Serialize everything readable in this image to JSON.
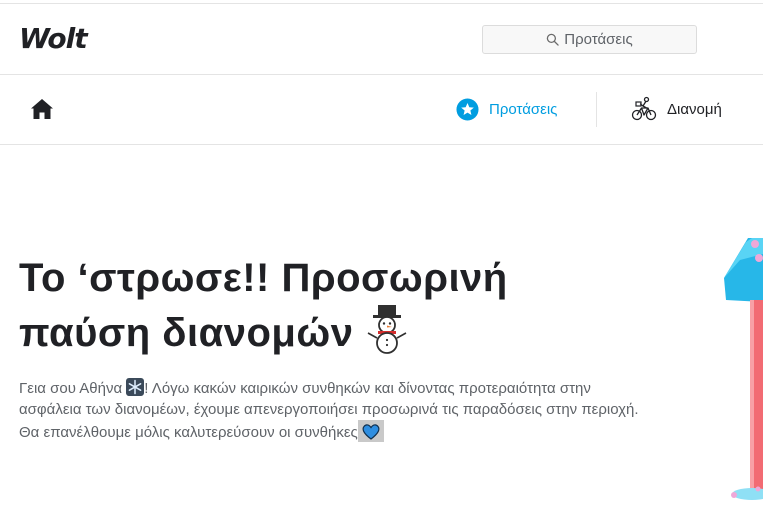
{
  "header": {
    "logo": "Wolt",
    "search": {
      "label": "Προτάσεις",
      "icon": "search-icon"
    }
  },
  "nav": {
    "home_icon": "home-icon",
    "recommendations": {
      "label": "Προτάσεις",
      "icon": "star-icon",
      "active": true
    },
    "delivery": {
      "label": "Διανομή",
      "icon": "bicycle-courier-icon"
    }
  },
  "hero": {
    "title_line1": "Το ‘στρωσε!! Προσωρινή",
    "title_line2": "παύση διανομών",
    "title_emoji": "snowman-icon",
    "text_part1": "Γεια σου Αθήνα",
    "text_emoji1": "snowflake-icon",
    "text_part2": "! Λόγω κακών καιρικών συνθηκών και δίνοντας προτεραιότητα στην ασφάλεια των διανομέων, έχουμε απενεργοποιήσει προσωρινά τις παραδόσεις στην περιοχή. Θα επανέλθουμε μόλις καλυτερεύσουν οι συνθήκες",
    "text_emoji2": "blue-heart-icon"
  },
  "colors": {
    "accent": "#009de0",
    "text": "#202125",
    "muted": "#5f6368",
    "border": "#e4e4e4"
  }
}
